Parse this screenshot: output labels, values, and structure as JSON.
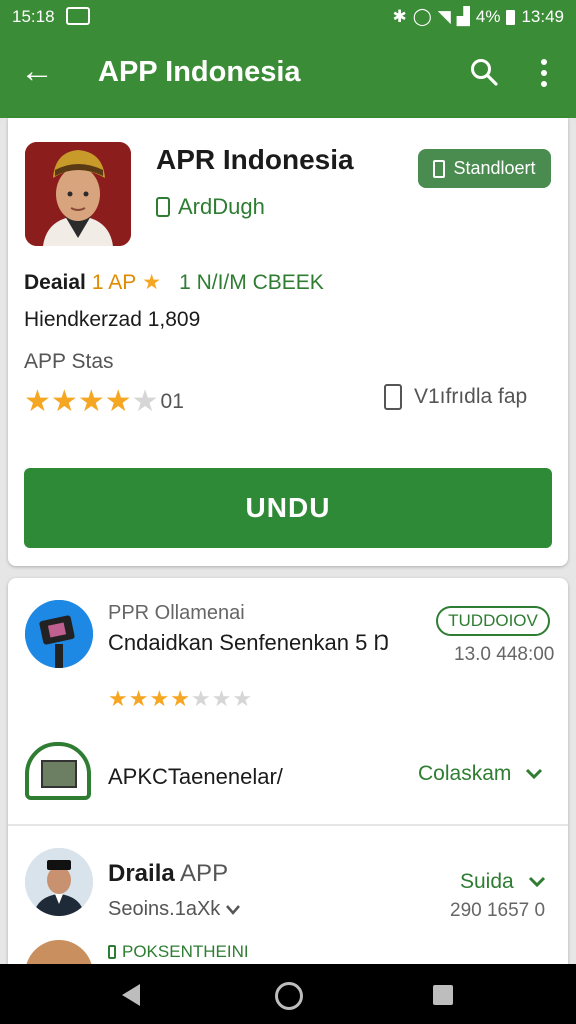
{
  "status_bar": {
    "time_left": "15:18",
    "battery": "4%",
    "time_right": "13:49"
  },
  "app_bar": {
    "title": "APP Indonesia",
    "icons": [
      "back-arrow-icon",
      "search-icon",
      "more-vert-icon"
    ]
  },
  "app_card": {
    "name": "APR Indonesia",
    "developer": "ArdDugh",
    "standard_button": "Standloert",
    "detail_label": "Deaial",
    "detail_rating": "1 AP",
    "detail_meta": "1 Ν/Ι/Μ CBEEK",
    "downloads": "Hiendkerzad 1,809",
    "stats_label": "APP Stas",
    "rating_stars": 4,
    "rating_count": "01",
    "device_text": "V1ıfrıdla fap",
    "install_button": "UNDU"
  },
  "list": {
    "item1": {
      "subtitle": "PPR Ollamenai",
      "title": "Cndaidkan Senfenenkan 5 Ŋ",
      "stars": 3.5,
      "tag": "TUDDOIOV",
      "time": "13.0 448:00"
    },
    "item2": {
      "title": "APKCTaenenelar/",
      "action": "Colaskam"
    },
    "item3": {
      "title_bold": "Draila",
      "title_rest": "APP",
      "subtitle": "Seoins.1aXk",
      "action": "Suida",
      "time": "290 1657 0"
    },
    "item4": {
      "label": "POKSENTHEINI"
    }
  },
  "colors": {
    "primary": "#3b8c36",
    "accent_button": "#2f8a37",
    "star": "#f5a623"
  }
}
